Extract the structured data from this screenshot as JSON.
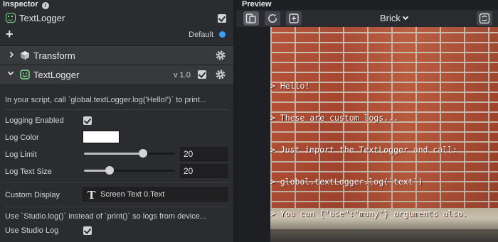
{
  "inspector": {
    "title": "Inspector",
    "object": {
      "name": "TextLogger",
      "enabled": true
    },
    "layer": {
      "label": "Default",
      "color": "#3aa0ff"
    },
    "transform": {
      "label": "Transform"
    },
    "component": {
      "name": "TextLogger",
      "version": "v 1.0",
      "enabled": true,
      "hint": "In your script, call `global.textLogger.log('Hello!')` to print...",
      "props": {
        "logging_enabled": {
          "label": "Logging Enabled",
          "checked": true
        },
        "log_color": {
          "label": "Log Color",
          "value": "#ffffff"
        },
        "log_limit": {
          "label": "Log Limit",
          "value": "20",
          "fraction": 0.65
        },
        "log_text_size": {
          "label": "Log Text Size",
          "value": "20",
          "fraction": 0.28
        },
        "custom_display": {
          "label": "Custom Display",
          "value": "Screen Text 0.Text"
        },
        "studio_hint": "Use `Studio.log()` instead of `print()` so logs from device...",
        "use_studio_log": {
          "label": "Use Studio Log",
          "checked": true
        }
      }
    }
  },
  "preview": {
    "title": "Preview",
    "device": "Brick",
    "log_lines": [
      "> Hello!",
      "> These are custom logs...",
      "> Just import the TextLogger and call:",
      "> global.textLogger.log(`text`)",
      "> You can {\"use\":\"many\"} arguments also."
    ]
  }
}
